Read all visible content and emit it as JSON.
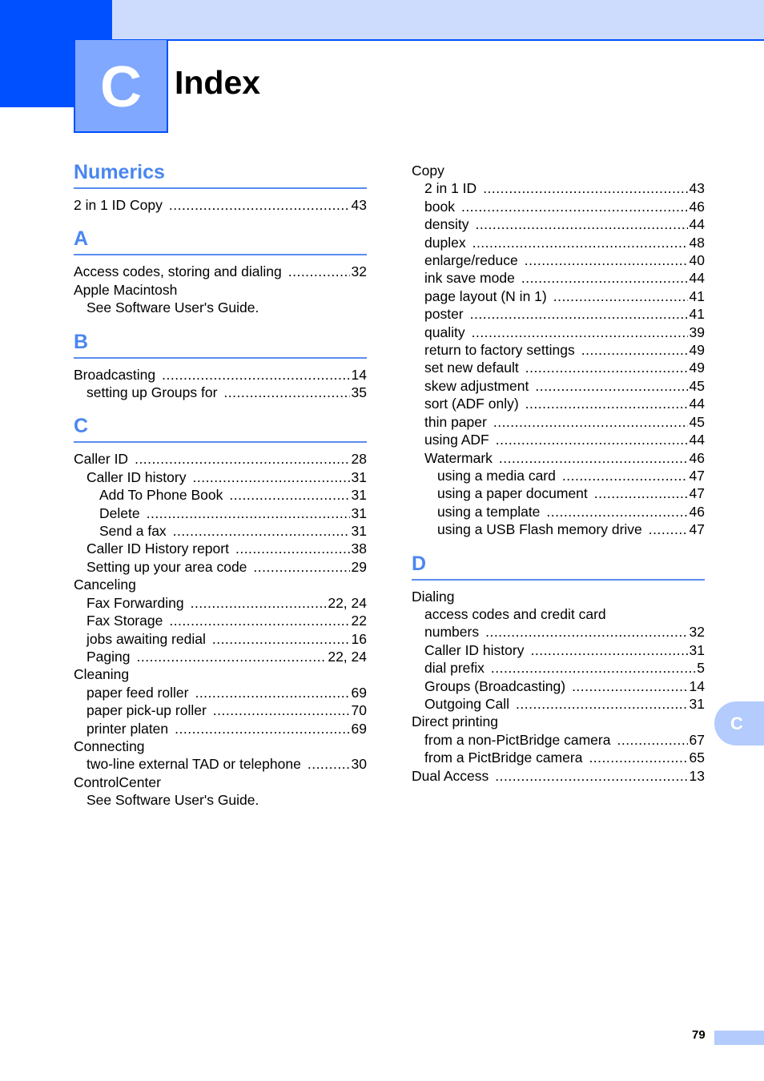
{
  "header": {
    "chapter_letter": "C",
    "title": "Index"
  },
  "left_column": [
    {
      "heading": "Numerics",
      "entries": [
        {
          "level": 1,
          "label": "2 in 1 ID Copy",
          "page": "43"
        }
      ]
    },
    {
      "heading": "A",
      "entries": [
        {
          "level": 1,
          "label": "Access codes, storing and dialing",
          "page": "32"
        },
        {
          "level": 1,
          "label": "Apple Macintosh",
          "page": ""
        },
        {
          "level": 2,
          "label": "See Software User's Guide.",
          "page": ""
        }
      ]
    },
    {
      "heading": "B",
      "entries": [
        {
          "level": 1,
          "label": "Broadcasting",
          "page": "14"
        },
        {
          "level": 2,
          "label": "setting up Groups for",
          "page": "35"
        }
      ]
    },
    {
      "heading": "C",
      "entries": [
        {
          "level": 1,
          "label": "Caller ID",
          "page": "28"
        },
        {
          "level": 2,
          "label": "Caller ID history",
          "page": "31"
        },
        {
          "level": 3,
          "label": "Add To Phone Book",
          "page": "31"
        },
        {
          "level": 3,
          "label": "Delete",
          "page": "31"
        },
        {
          "level": 3,
          "label": "Send a fax",
          "page": "31"
        },
        {
          "level": 2,
          "label": "Caller ID History report",
          "page": "38"
        },
        {
          "level": 2,
          "label": "Setting up your area code",
          "page": "29"
        },
        {
          "level": 1,
          "label": "Canceling",
          "page": ""
        },
        {
          "level": 2,
          "label": "Fax Forwarding",
          "page": "22, 24"
        },
        {
          "level": 2,
          "label": "Fax Storage",
          "page": "22"
        },
        {
          "level": 2,
          "label": "jobs awaiting redial",
          "page": "16"
        },
        {
          "level": 2,
          "label": "Paging",
          "page": "22, 24"
        },
        {
          "level": 1,
          "label": "Cleaning",
          "page": ""
        },
        {
          "level": 2,
          "label": "paper feed roller",
          "page": "69"
        },
        {
          "level": 2,
          "label": "paper pick-up roller",
          "page": "70"
        },
        {
          "level": 2,
          "label": "printer platen",
          "page": "69"
        },
        {
          "level": 1,
          "label": "Connecting",
          "page": ""
        },
        {
          "level": 2,
          "label": "two-line external TAD or telephone",
          "page": "30"
        },
        {
          "level": 1,
          "label": "ControlCenter",
          "page": ""
        },
        {
          "level": 2,
          "label": "See Software User's Guide.",
          "page": ""
        }
      ]
    }
  ],
  "right_column": [
    {
      "heading": "",
      "entries": [
        {
          "level": 1,
          "label": "Copy",
          "page": ""
        },
        {
          "level": 2,
          "label": "2 in 1 ID",
          "page": "43"
        },
        {
          "level": 2,
          "label": "book",
          "page": "46"
        },
        {
          "level": 2,
          "label": "density",
          "page": "44"
        },
        {
          "level": 2,
          "label": "duplex",
          "page": "48"
        },
        {
          "level": 2,
          "label": "enlarge/reduce",
          "page": "40"
        },
        {
          "level": 2,
          "label": "ink save mode",
          "page": "44"
        },
        {
          "level": 2,
          "label": "page layout (N in 1)",
          "page": "41"
        },
        {
          "level": 2,
          "label": "poster",
          "page": "41"
        },
        {
          "level": 2,
          "label": "quality",
          "page": "39"
        },
        {
          "level": 2,
          "label": "return to factory settings",
          "page": "49"
        },
        {
          "level": 2,
          "label": "set new default",
          "page": "49"
        },
        {
          "level": 2,
          "label": "skew adjustment",
          "page": "45"
        },
        {
          "level": 2,
          "label": "sort (ADF only)",
          "page": "44"
        },
        {
          "level": 2,
          "label": "thin paper",
          "page": "45"
        },
        {
          "level": 2,
          "label": "using ADF",
          "page": "44"
        },
        {
          "level": 2,
          "label": "Watermark",
          "page": "46"
        },
        {
          "level": 3,
          "label": "using a media card",
          "page": "47"
        },
        {
          "level": 3,
          "label": "using a paper document",
          "page": "47"
        },
        {
          "level": 3,
          "label": "using a template",
          "page": "46"
        },
        {
          "level": 3,
          "label": "using a USB Flash memory drive",
          "page": "47"
        }
      ]
    },
    {
      "heading": "D",
      "entries": [
        {
          "level": 1,
          "label": "Dialing",
          "page": ""
        },
        {
          "level": 2,
          "label": "access codes and credit card",
          "page": ""
        },
        {
          "level": 2,
          "label": "numbers",
          "page": "32"
        },
        {
          "level": 2,
          "label": "Caller ID history",
          "page": "31"
        },
        {
          "level": 2,
          "label": "dial prefix",
          "page": "5"
        },
        {
          "level": 2,
          "label": "Groups (Broadcasting)",
          "page": "14"
        },
        {
          "level": 2,
          "label": "Outgoing Call",
          "page": "31"
        },
        {
          "level": 1,
          "label": "Direct printing",
          "page": ""
        },
        {
          "level": 2,
          "label": "from a non-PictBridge camera",
          "page": "67"
        },
        {
          "level": 2,
          "label": "from a PictBridge camera",
          "page": "65"
        },
        {
          "level": 1,
          "label": "Dual Access",
          "page": "13"
        }
      ]
    }
  ],
  "side_tab": {
    "letter": "C"
  },
  "footer": {
    "page_number": "79"
  },
  "colors": {
    "accent": "#0050ff",
    "heading": "#4a86f0",
    "light": "#cddcfd",
    "tab": "#b3cbfd"
  }
}
